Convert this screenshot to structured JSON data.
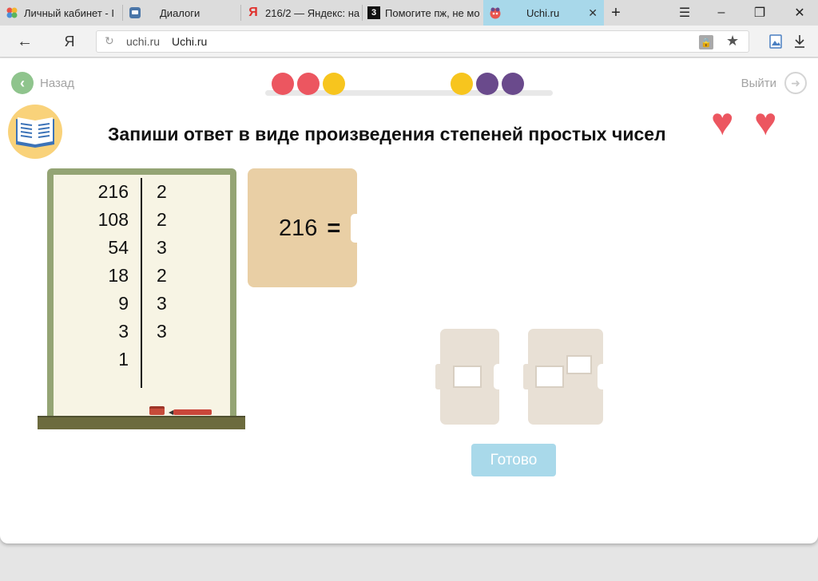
{
  "browser": {
    "tabs": [
      {
        "label": "Личный кабинет - I",
        "icon": "multicolor-dots-icon"
      },
      {
        "label": "Диалоги",
        "icon": "chat-icon"
      },
      {
        "label": "216/2 — Яндекс: на",
        "icon": "yandex-icon"
      },
      {
        "label": "Помогите пж, не мо",
        "icon": "znanija-icon"
      },
      {
        "label": "Uchi.ru",
        "icon": "uchi-icon",
        "active": true
      }
    ],
    "new_tab": "+",
    "yandex_logo": "Я",
    "url_domain": "uchi.ru",
    "page_title": "Uchi.ru"
  },
  "nav": {
    "back_label": "Назад",
    "exit_label": "Выйти"
  },
  "progress": {
    "dots": [
      "#ec5660",
      "#ec5660",
      "#f7c51e",
      null,
      null,
      null,
      null,
      "#f7c51e",
      "#6a4a8c",
      "#6a4a8c"
    ]
  },
  "task": {
    "title": "Запиши ответ в виде произведения степеней простых чисел",
    "lives": 2
  },
  "factorization": {
    "dividends": [
      "216",
      "108",
      "54",
      "18",
      "9",
      "3",
      "1"
    ],
    "divisors": [
      "2",
      "2",
      "3",
      "2",
      "3",
      "3"
    ]
  },
  "equation": {
    "left": "216",
    "sign": "="
  },
  "buttons": {
    "done_label": "Готово"
  },
  "colors": {
    "accent_green": "#8fc48d",
    "heart": "#ec5660",
    "done_button": "#a9d9ea",
    "card": "#e9cfa5",
    "tile": "#e8e0d5"
  }
}
